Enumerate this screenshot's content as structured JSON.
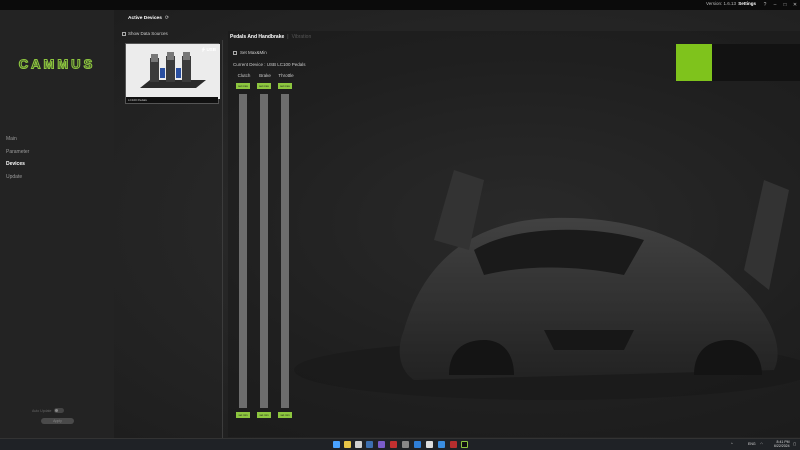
{
  "titlebar": {
    "version_text": "Version:  1.6.13",
    "settings_label": "Settings"
  },
  "sidebar": {
    "logo_text": "CAMMUS",
    "items": [
      {
        "label": "Main"
      },
      {
        "label": "Parameter"
      },
      {
        "label": "Devices"
      },
      {
        "label": "Update"
      }
    ],
    "auto_update_label": "Auto Update",
    "apply_label": "Apply"
  },
  "devices": {
    "active_devices_label": "Active Devices",
    "show_data_sources_label": "Show Data Sources",
    "card": {
      "connection": "USB",
      "name": "LC100 Pedals"
    }
  },
  "panel": {
    "tab_active": "Pedals And Handbrake",
    "tab_separator": "|",
    "tab_inactive": "Vibration",
    "set_max_label": "Set Max&Min",
    "current_device": "Current Device : USB LC100 Pedals",
    "pedals": [
      {
        "name": "Clutch",
        "set_max_label": "set max",
        "set_min_label": "set min",
        "value": 0
      },
      {
        "name": "Brake",
        "set_max_label": "set max",
        "set_min_label": "set min",
        "value": 0
      },
      {
        "name": "Throttle",
        "set_max_label": "set max",
        "set_min_label": "set min",
        "value": 0
      }
    ]
  },
  "taskbar": {
    "language": "ENG",
    "time": "8:41 PM",
    "date": "6/22/2024"
  },
  "colors": {
    "accent": "#8dc63f",
    "logo": "#8dc63f",
    "accent_square": "#7fc31c"
  }
}
